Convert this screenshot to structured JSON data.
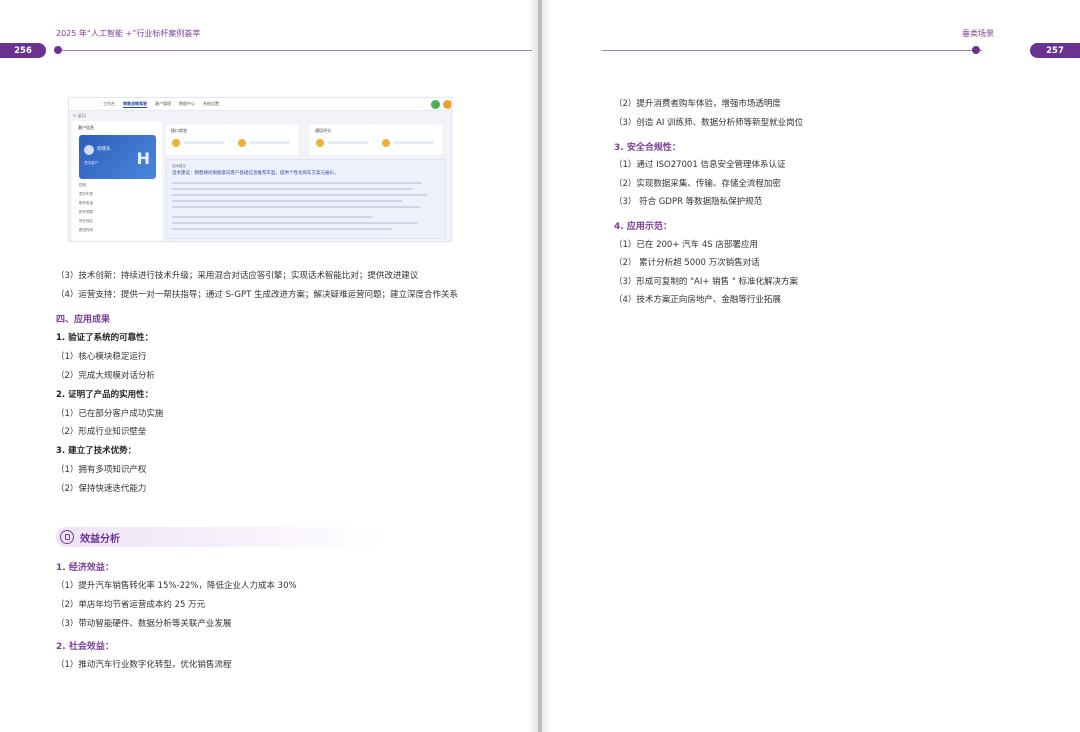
{
  "left_page": {
    "header_title": "2025 年“人工智能 +”行业标杆案例荟萃",
    "page_number": "256",
    "screenshot": {
      "tabs": [
        "工作台",
        "销售战略驾驶",
        "客户管理",
        "数据中心",
        "系统设置"
      ],
      "crumb": "< 返回",
      "panel_title": "客户信息",
      "card_name": "何晓东",
      "card_tag": "意向客户",
      "card_letter": "H",
      "kv_labels": [
        "性别",
        "意向车型",
        "联系电话",
        "购车预算",
        "所在地区",
        "跟进时间"
      ],
      "mini_titles": [
        "接口状态",
        "通话评分"
      ],
      "rec_title": "话术建议",
      "rec_headline": "话术建议：销售顾问根据意向客户基础信息推荐车型，提供个性化购车方案与报价。"
    },
    "lines": [
      "（3）技术创新：持续进行技术升级；采用混合对话应答引擎；实现话术智能比对；提供改进建议",
      "（4）运营支持：提供一对一帮扶指导；通过 S-GPT 生成改进方案；解决疑难运营问题；建立深度合作关系"
    ],
    "section_four": "四、应用成果",
    "groups": [
      {
        "heading": "1. 验证了系统的可靠性：",
        "items": [
          "（1）核心模块稳定运行",
          "（2）完成大规模对话分析"
        ]
      },
      {
        "heading": "2. 证明了产品的实用性：",
        "items": [
          "（1）已在部分客户成功实施",
          "（2）形成行业知识壁垒"
        ]
      },
      {
        "heading": "3. 建立了技术优势：",
        "items": [
          "（1）拥有多项知识产权",
          "（2）保持快速迭代能力"
        ]
      }
    ],
    "banner": "效益分析",
    "economic_heading": "1. 经济效益：",
    "economic_items": [
      "（1）提升汽车销售转化率 15%-22%，降低企业人力成本 30%",
      "（2）单店年均节省运营成本约 25 万元",
      "（3）带动智能硬件、数据分析等关联产业发展"
    ],
    "social_heading": "2. 社会效益：",
    "social_items": [
      "（1）推动汽车行业数字化转型，优化销售流程"
    ]
  },
  "right_page": {
    "header_title": "垂类场景",
    "page_number": "257",
    "top_items": [
      "（2）提升消费者购车体验，增强市场透明度",
      "（3）创造 AI 训练师、数据分析师等新型就业岗位"
    ],
    "compliance_heading": "3. 安全合规性：",
    "compliance_items": [
      "（1）通过 ISO27001 信息安全管理体系认证",
      "（2）实现数据采集、传输、存储全流程加密",
      "（3） 符合 GDPR 等数据隐私保护规范"
    ],
    "demo_heading": "4. 应用示范：",
    "demo_items": [
      "（1）已在 200+ 汽车 4S 店部署应用",
      "（2） 累计分析超 5000 万次销售对话",
      "（3）形成可复制的 \"AI+ 销售 \" 标准化解决方案",
      "（4）技术方案正向房地产、金融等行业拓展"
    ]
  },
  "colors": {
    "accent": "#7a3f98",
    "badge": "#6b3291",
    "body_text": "#333333"
  }
}
